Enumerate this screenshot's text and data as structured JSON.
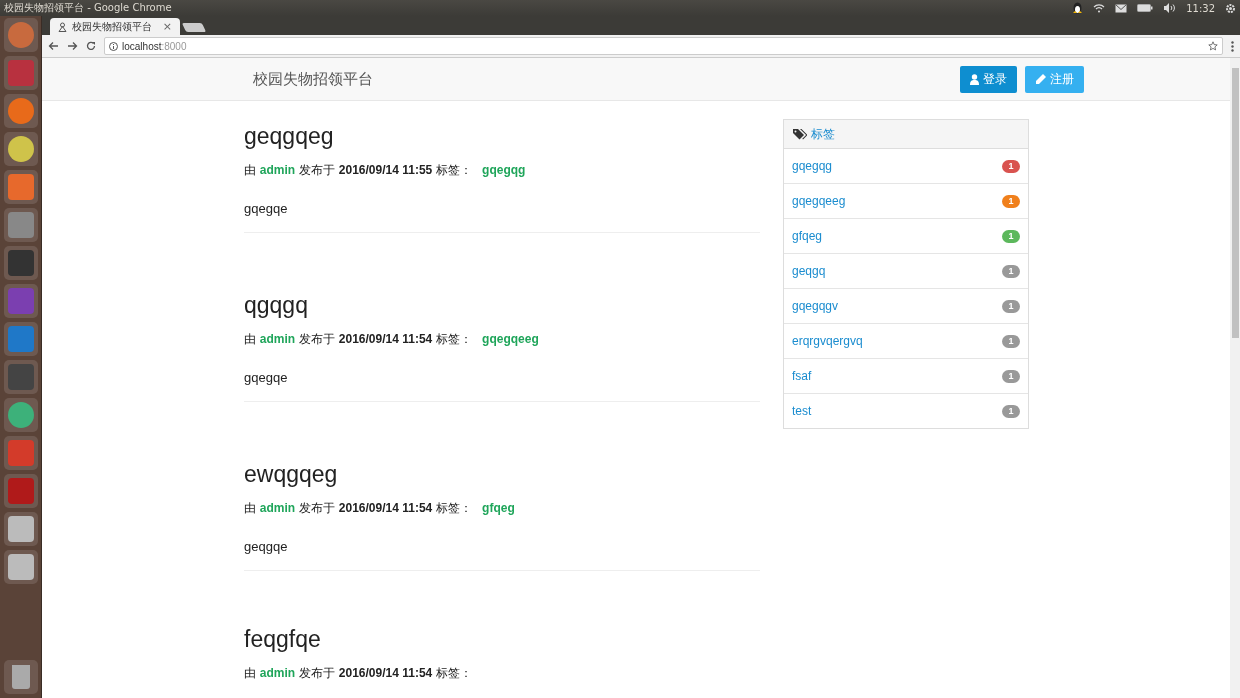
{
  "os_bar": {
    "title": "校园失物招领平台 - Google Chrome",
    "time": "11:32"
  },
  "browser": {
    "tab": {
      "label": "校园失物招领平台",
      "close": "×"
    },
    "url": {
      "host": "localhost",
      "port": ":8000"
    }
  },
  "navbar": {
    "brand": "校园失物招领平台",
    "buttons": [
      {
        "kind": "login",
        "label": "登录"
      },
      {
        "kind": "register",
        "label": "注册"
      }
    ]
  },
  "posts": [
    {
      "title": "geqgqeg",
      "meta": {
        "prefix": "由",
        "author": "admin",
        "verb": "发布于",
        "date": "2016/09/14 11:55",
        "tag_label": "标签：",
        "tag": "gqegqg"
      },
      "body": "gqegqe"
    },
    {
      "title": "qgqgq",
      "meta": {
        "prefix": "由",
        "author": "admin",
        "verb": "发布于",
        "date": "2016/09/14 11:54",
        "tag_label": "标签：",
        "tag": "gqegqeeg"
      },
      "body": "gqegqe"
    },
    {
      "title": "ewqgqeg",
      "meta": {
        "prefix": "由",
        "author": "admin",
        "verb": "发布于",
        "date": "2016/09/14 11:54",
        "tag_label": "标签：",
        "tag": "gfqeg"
      },
      "body": "geqgqe"
    },
    {
      "title": "feqgfqe",
      "meta": {
        "prefix": "由",
        "author": "admin",
        "verb": "发布于",
        "date": "2016/09/14 11:54",
        "tag_label": "标签："
      }
    }
  ],
  "sidebar": {
    "title": "标签",
    "tags": [
      {
        "name": "gqegqg",
        "count": "1",
        "color": "#d9534f"
      },
      {
        "name": "gqegqeeg",
        "count": "1",
        "color": "#f0801c"
      },
      {
        "name": "gfqeg",
        "count": "1",
        "color": "#5cb85c"
      },
      {
        "name": "geqgq",
        "count": "1",
        "color": "#999999"
      },
      {
        "name": "gqegqgv",
        "count": "1",
        "color": "#999999"
      },
      {
        "name": "erqrgvqergvq",
        "count": "1",
        "color": "#999999"
      },
      {
        "name": "fsaf",
        "count": "1",
        "color": "#999999"
      },
      {
        "name": "test",
        "count": "1",
        "color": "#999999"
      }
    ]
  }
}
